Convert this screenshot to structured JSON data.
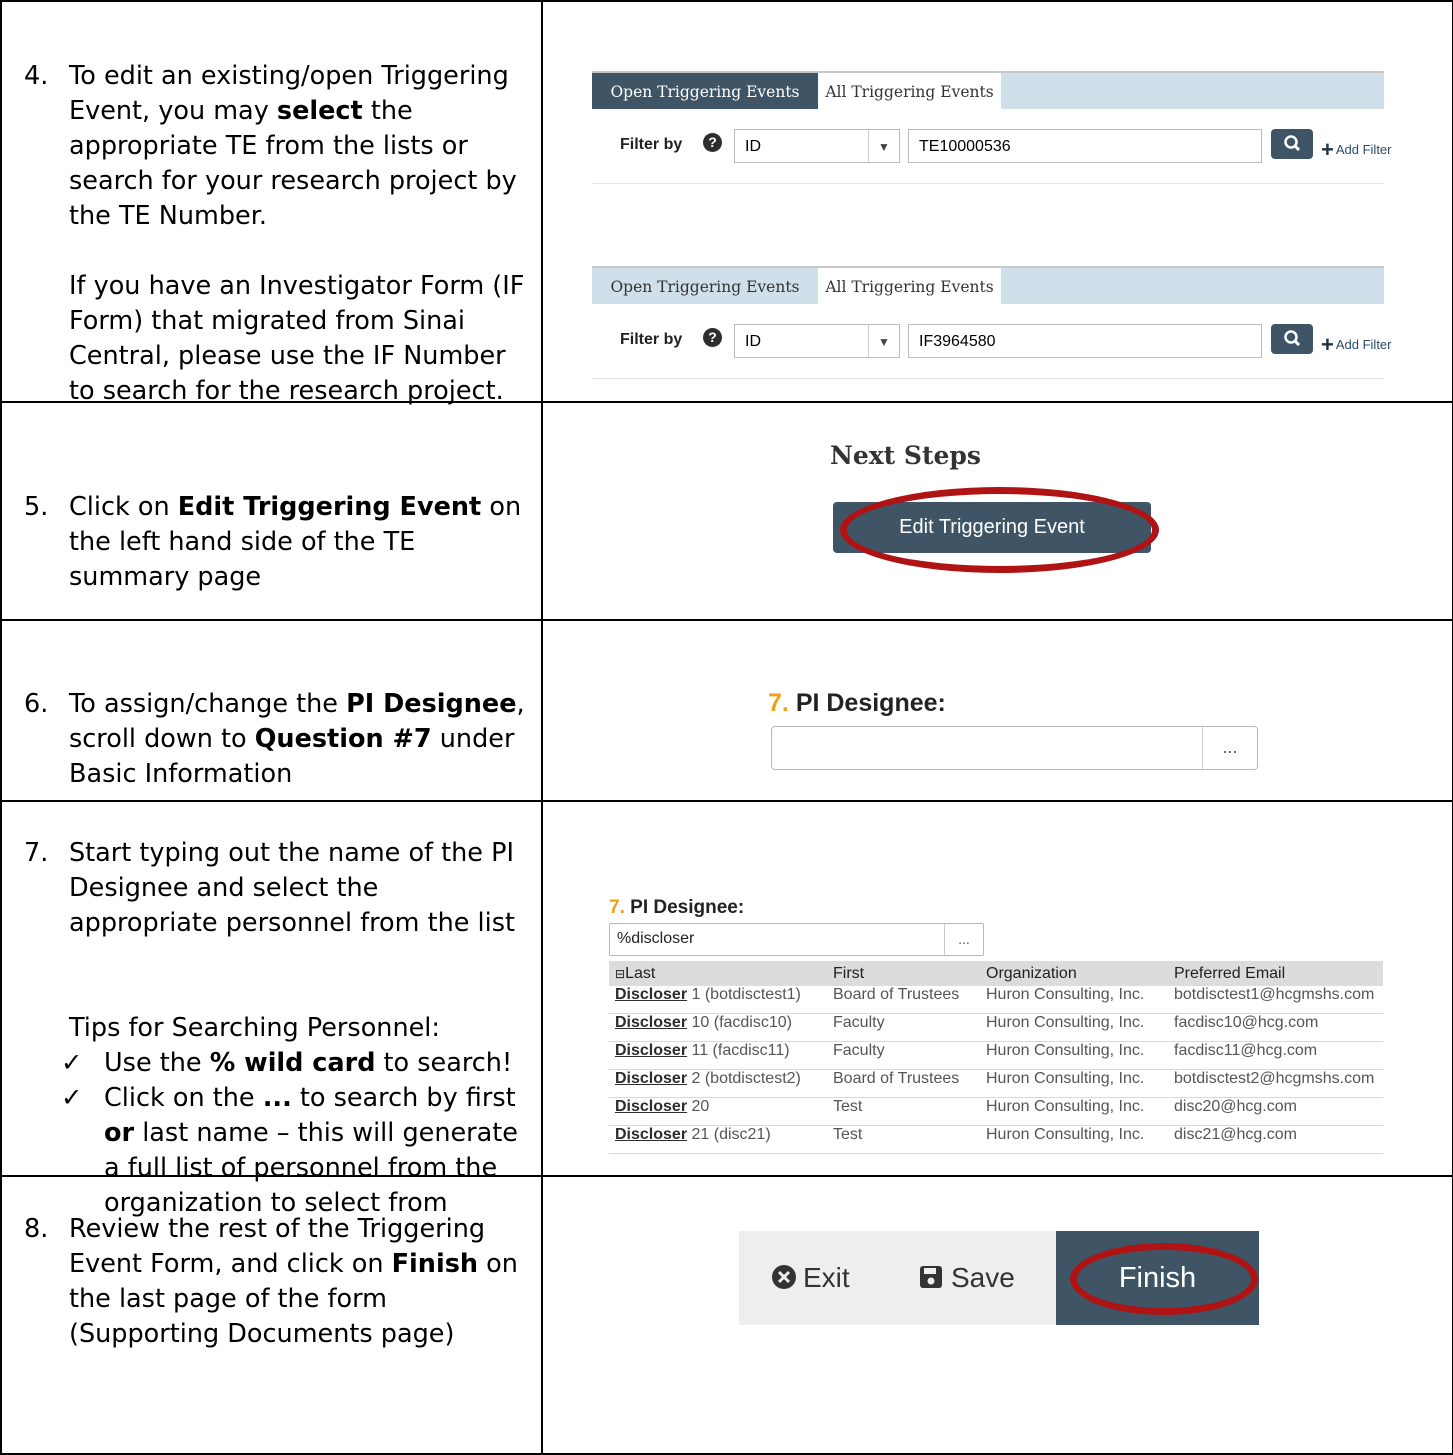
{
  "rows": [
    {
      "num": "4.",
      "para1_parts": [
        "To edit an existing/open Triggering Event, you may ",
        "select",
        " the appropriate TE from the lists or search for your research project by the TE Number."
      ],
      "para2": "If you have an Investigator Form (IF Form) that migrated from Sinai Central, please use the IF Number to search for the research project."
    },
    {
      "num": "5.",
      "parts": [
        "Click on ",
        "Edit Triggering Event",
        " on the left hand side of the TE summary page"
      ]
    },
    {
      "num": "6.",
      "parts": [
        "To assign/change the ",
        "PI Designee",
        ", scroll down to ",
        "Question #7",
        " under Basic Information"
      ]
    },
    {
      "num": "7.",
      "para1": "Start typing out the name of the PI Designee and select the appropriate personnel from the list",
      "tips_heading": "Tips for Searching Personnel:",
      "tip1_parts": [
        "Use the ",
        "% wild card",
        " to search!"
      ],
      "tip2_parts": [
        "Click on the ",
        "...",
        " to search by first ",
        "or",
        " last name – this will generate a full list of personnel from the organization to select from"
      ],
      "check": "✓"
    },
    {
      "num": "8.",
      "parts": [
        "Review the rest of the Triggering Event Form, and click on ",
        "Finish",
        " on the last page of the form (Supporting Documents page)"
      ]
    }
  ],
  "filters": {
    "tab_open": "Open Triggering Events",
    "tab_all": "All Triggering Events",
    "filter_label": "Filter by",
    "help_glyph": "?",
    "select_value": "ID",
    "add_filter": "Add Filter",
    "te_value": "TE10000536",
    "if_value": "IF3964580"
  },
  "next_steps": {
    "heading": "Next Steps",
    "button": "Edit Triggering Event"
  },
  "pi_designee": {
    "number": "7.",
    "label": "PI Designee:",
    "dots": "...",
    "search_value": "%discloser"
  },
  "personnel": {
    "headers": [
      "Last",
      "First",
      "Organization",
      "Preferred Email"
    ],
    "rows": [
      {
        "last": "Discloser",
        "rest": " 1 (botdisctest1)",
        "first": "Board of Trustees",
        "org": "Huron Consulting, Inc.",
        "email": "botdisctest1@hcgmshs.com"
      },
      {
        "last": "Discloser",
        "rest": " 10 (facdisc10)",
        "first": "Faculty",
        "org": "Huron Consulting, Inc.",
        "email": "facdisc10@hcg.com"
      },
      {
        "last": "Discloser",
        "rest": " 11 (facdisc11)",
        "first": "Faculty",
        "org": "Huron Consulting, Inc.",
        "email": "facdisc11@hcg.com"
      },
      {
        "last": "Discloser",
        "rest": " 2 (botdisctest2)",
        "first": "Board of Trustees",
        "org": "Huron Consulting, Inc.",
        "email": "botdisctest2@hcgmshs.com"
      },
      {
        "last": "Discloser",
        "rest": " 20",
        "first": "Test",
        "org": "Huron Consulting, Inc.",
        "email": "disc20@hcg.com"
      },
      {
        "last": "Discloser",
        "rest": " 21 (disc21)",
        "first": "Test",
        "org": "Huron Consulting, Inc.",
        "email": "disc21@hcg.com"
      }
    ]
  },
  "finish_bar": {
    "exit": "Exit",
    "save": "Save",
    "finish": "Finish"
  },
  "colors": {
    "dark_button": "#3f5565",
    "tab_light": "#cfe0ea",
    "highlight_ellipse": "#b01313",
    "question_number": "#f0a11a"
  },
  "icons": [
    "help-circle-icon",
    "dropdown-arrow-icon",
    "search-icon",
    "plus-icon",
    "collapse-icon",
    "close-circle-icon",
    "save-disk-icon",
    "checkmark-icon"
  ]
}
